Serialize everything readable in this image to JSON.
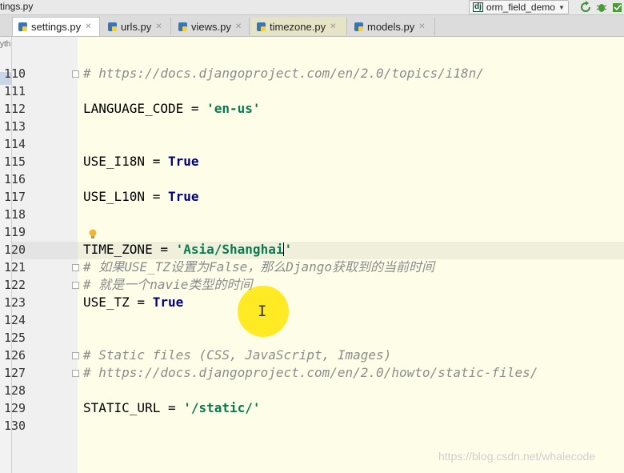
{
  "titlebar": {
    "file": "tings.py",
    "run_config": "orm_field_demo",
    "dj_badge": "dj"
  },
  "tabs": [
    {
      "label": "settings.py",
      "active": true
    },
    {
      "label": "urls.py"
    },
    {
      "label": "views.py"
    },
    {
      "label": "timezone.py"
    },
    {
      "label": "models.py"
    }
  ],
  "sidebar": {
    "fragment": "yth"
  },
  "lines": [
    "110",
    "111",
    "112",
    "113",
    "114",
    "115",
    "116",
    "117",
    "118",
    "119",
    "120",
    "121",
    "122",
    "123",
    "124",
    "125",
    "126",
    "127",
    "128",
    "129",
    "130"
  ],
  "code": {
    "c110": "# https://docs.djangoproject.com/en/2.0/topics/i18n/",
    "lang_var": "LANGUAGE_CODE = ",
    "lang_val": "'en-us'",
    "i18n_var": "USE_I18N = ",
    "i18n_val": "True",
    "l10n_var": "USE_L10N = ",
    "l10n_val": "True",
    "tz_var": "TIME_ZONE = ",
    "tz_q1": "'",
    "tz_val": "Asia/Shanghai",
    "tz_q2": "'",
    "c121": "# 如果USE_TZ设置为False，那么Django获取到的当前时间",
    "c122": "# 就是一个navie类型的时间",
    "usetz_var": "USE_TZ = ",
    "usetz_val": "True",
    "c126": "# Static files (CSS, JavaScript, Images)",
    "c127": "# https://docs.djangoproject.com/en/2.0/howto/static-files/",
    "static_var": "STATIC_URL = ",
    "static_val": "'/static/'"
  },
  "cursor": {
    "glyph": "I"
  },
  "watermark": "https://blog.csdn.net/whalecode",
  "colors": {
    "editor_bg": "#fdfde8",
    "string": "#0b7a50",
    "comment": "#8c8c8c",
    "cursor_halo": "#ffe600"
  }
}
